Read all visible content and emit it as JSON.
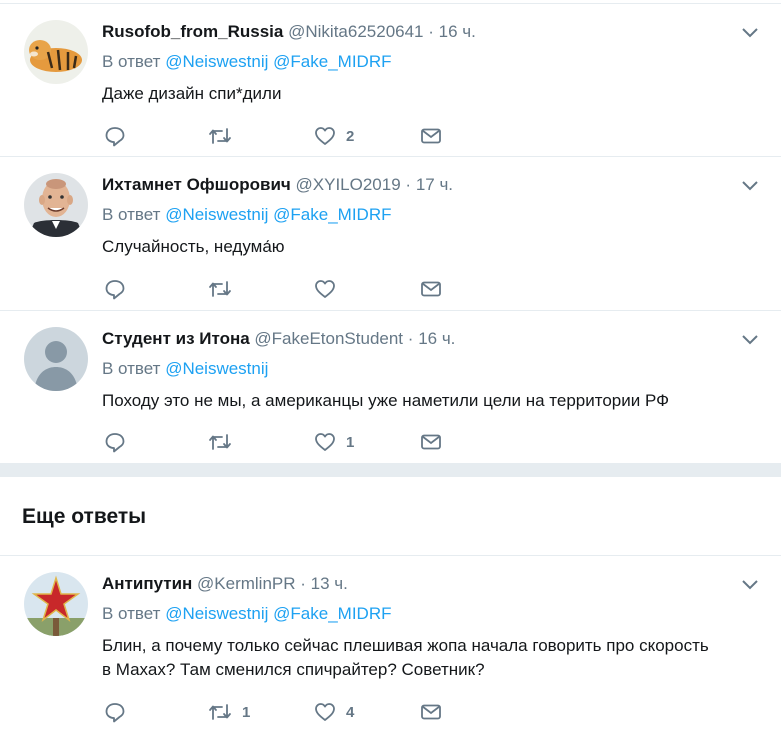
{
  "tweets": [
    {
      "name": "Rusofob_from_Russia",
      "handle": "@Nikita62520641",
      "time": "16 ч.",
      "reply_prefix": "В ответ",
      "mentions": [
        "@Neiswestnij",
        "@Fake_MIDRF"
      ],
      "text": "Даже дизайн спи*дили",
      "likes": "2",
      "retweets": ""
    },
    {
      "name": "Ихтамнет Офшорович",
      "handle": "@XYILO2019",
      "time": "17 ч.",
      "reply_prefix": "В ответ",
      "mentions": [
        "@Neiswestnij",
        "@Fake_MIDRF"
      ],
      "text": "Случайность, недума́ю",
      "likes": "",
      "retweets": ""
    },
    {
      "name": "Студент из Итона",
      "handle": "@FakeEtonStudent",
      "time": "16 ч.",
      "reply_prefix": "В ответ",
      "mentions": [
        "@Neiswestnij"
      ],
      "text": "Походу это не мы, а американцы уже наметили цели на территории РФ",
      "likes": "1",
      "retweets": ""
    }
  ],
  "more_replies_title": "Еще ответы",
  "more_tweets": [
    {
      "name": "Антипутин",
      "handle": "@KermlinPR",
      "time": "13 ч.",
      "reply_prefix": "В ответ",
      "mentions": [
        "@Neiswestnij",
        "@Fake_MIDRF"
      ],
      "text_line1": "Блин, а почему только сейчас плешивая жопа начала говорить про скорость",
      "text_line2": "в Махах? Там сменился спичрайтер? Советник?",
      "likes": "4",
      "retweets": "1"
    }
  ],
  "separator_dot": "·",
  "colors": {
    "link": "#1da1f2",
    "muted": "#657786",
    "divider": "#e6ecf0"
  },
  "icons": [
    "reply-icon",
    "retweet-icon",
    "like-icon",
    "direct-message-icon",
    "chevron-down-icon"
  ]
}
